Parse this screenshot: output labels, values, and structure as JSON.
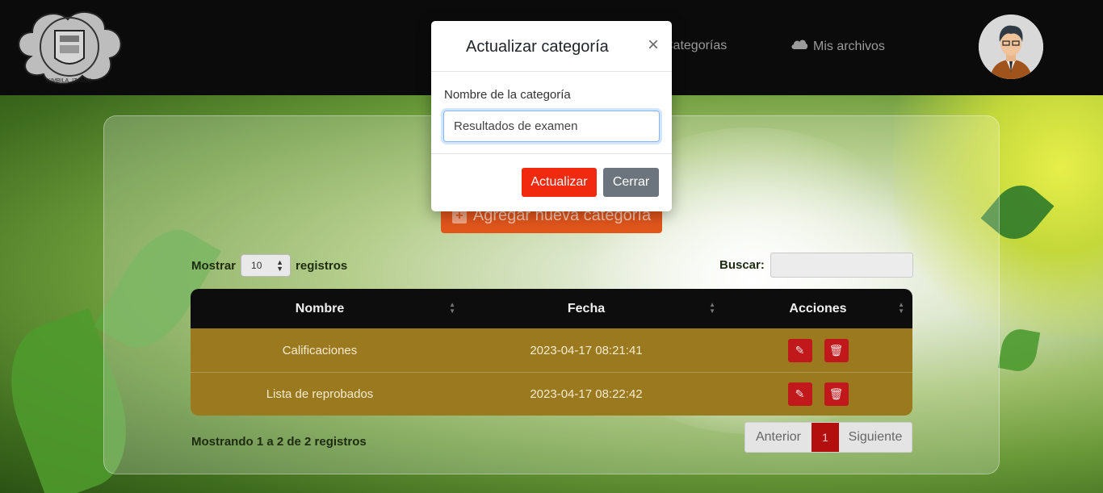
{
  "navbar": {
    "logo_alt_lines": [
      "ROBERTO ARTURO HERNANDEZ VALDERIO",
      "KIMBILA, IZAMAL"
    ],
    "links": [
      {
        "label": "Categorías",
        "icon": "folder-icon"
      },
      {
        "label": "Mis archivos",
        "icon": "cloud-icon"
      }
    ],
    "avatar": "user-avatar"
  },
  "page": {
    "add_button_label": "Agregar nueva categoría",
    "length_prefix": "Mostrar",
    "length_value": "10",
    "length_suffix": "registros",
    "search_label": "Buscar:",
    "search_value": ""
  },
  "table": {
    "columns": [
      "Nombre",
      "Fecha",
      "Acciones"
    ],
    "rows": [
      {
        "nombre": "Calificaciones",
        "fecha": "2023-04-17 08:21:41"
      },
      {
        "nombre": "Lista de reprobados",
        "fecha": "2023-04-17 08:22:42"
      }
    ],
    "info": "Mostrando 1 a 2 de 2 registros",
    "pagination": {
      "prev": "Anterior",
      "current": "1",
      "next": "Siguiente"
    }
  },
  "modal": {
    "title": "Actualizar categoría",
    "close_symbol": "×",
    "field_label": "Nombre de la categoría",
    "field_value": "Resultados de examen",
    "update_button": "Actualizar",
    "close_button": "Cerrar"
  },
  "colors": {
    "navbar": "#0b0b0b",
    "add_button": "#e2561c",
    "row_bg": "#9b7a1f",
    "action_button": "#c0181b",
    "update_button": "#f0290f",
    "close_button": "#6c757d",
    "pager_active": "#b30f0f"
  }
}
